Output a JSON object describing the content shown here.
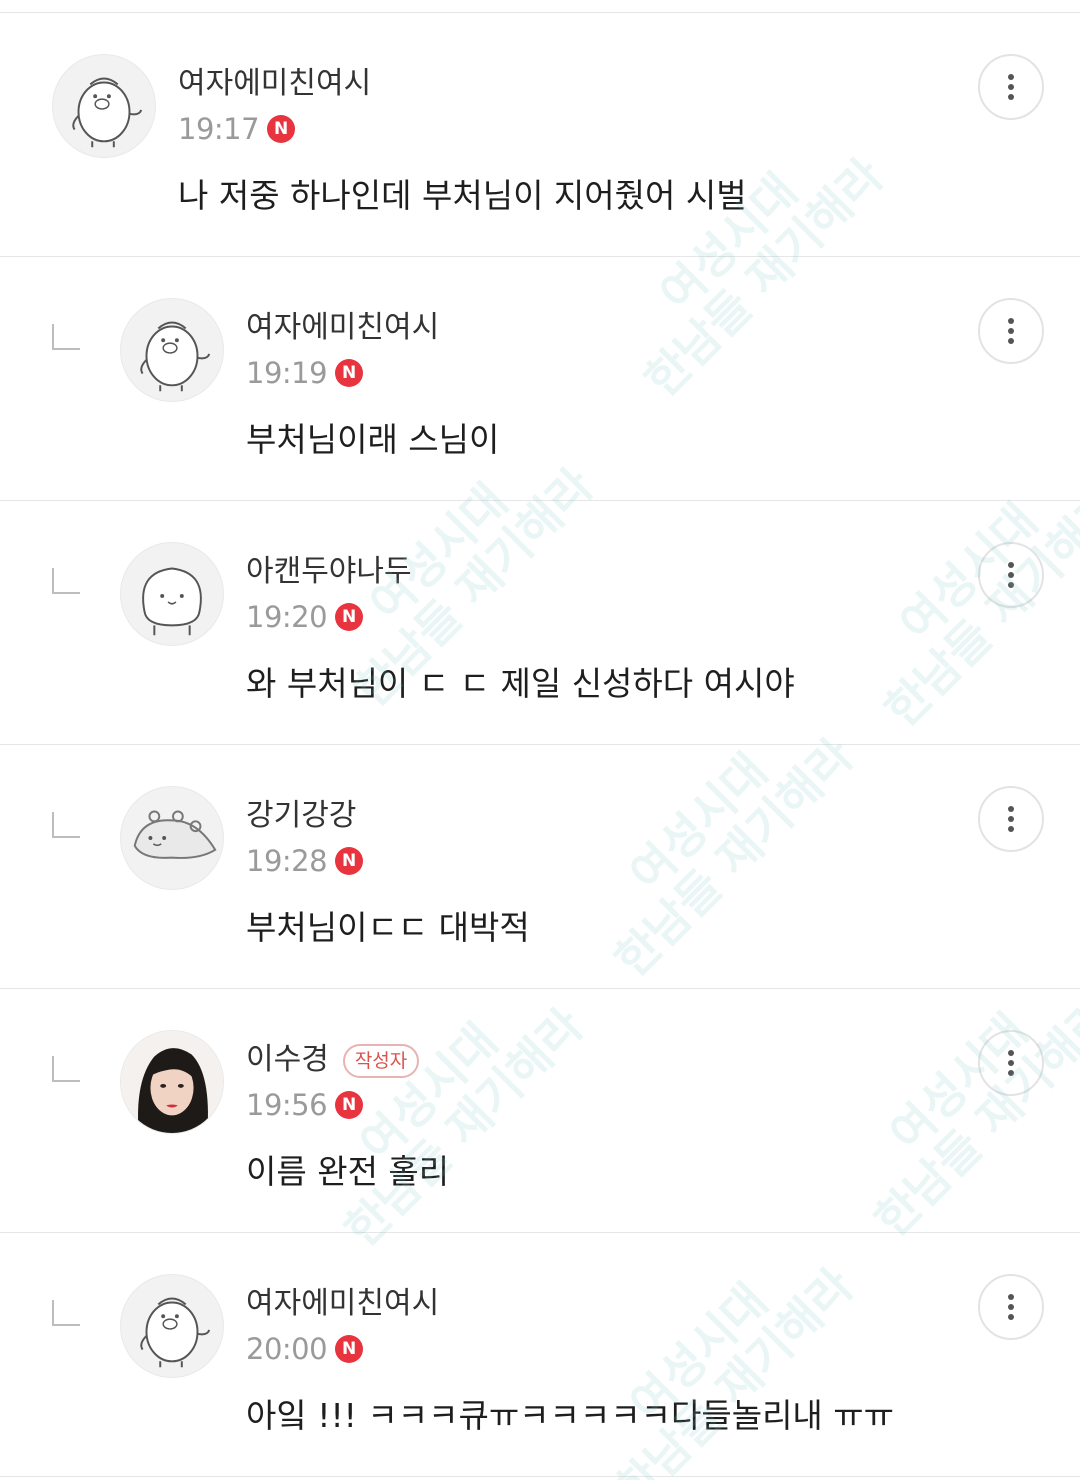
{
  "comments": [
    {
      "author": "여자에미친여시",
      "time": "19:17",
      "badge": "N",
      "text": "나 저중 하나인데 부처님이 지어줬어 시벌",
      "is_reply": false,
      "avatar": "penguin-icon"
    },
    {
      "author": "여자에미친여시",
      "time": "19:19",
      "badge": "N",
      "text": "부처님이래 스님이",
      "is_reply": true,
      "avatar": "penguin-icon"
    },
    {
      "author": "아캔두야나두",
      "time": "19:20",
      "badge": "N",
      "text": "와 부처님이 ㄷ ㄷ 제일 신성하다 여시야",
      "is_reply": true,
      "avatar": "blob-icon"
    },
    {
      "author": "강기강강",
      "time": "19:28",
      "badge": "N",
      "text": "부처님이ㄷㄷ 대박적",
      "is_reply": true,
      "avatar": "fish-icon"
    },
    {
      "author": "이수경",
      "author_tag": "작성자",
      "time": "19:56",
      "badge": "N",
      "text": "이름 완전 홀리",
      "is_reply": true,
      "avatar": "profile-photo"
    },
    {
      "author": "여자에미친여시",
      "time": "20:00",
      "badge": "N",
      "text": "아잌 !!! ㅋㅋㅋ큐ㅠㅋㅋㅋㅋㅋ다들놀리내 ㅠㅠ",
      "is_reply": true,
      "avatar": "penguin-icon"
    }
  ],
  "watermark": {
    "line1": "여성시대",
    "line2": "한남들 재기해라"
  },
  "colors": {
    "badge": "#e8343f",
    "author_tag": "#d9534f",
    "divider": "#e6e6e6",
    "timestamp": "#9a9a9a"
  }
}
